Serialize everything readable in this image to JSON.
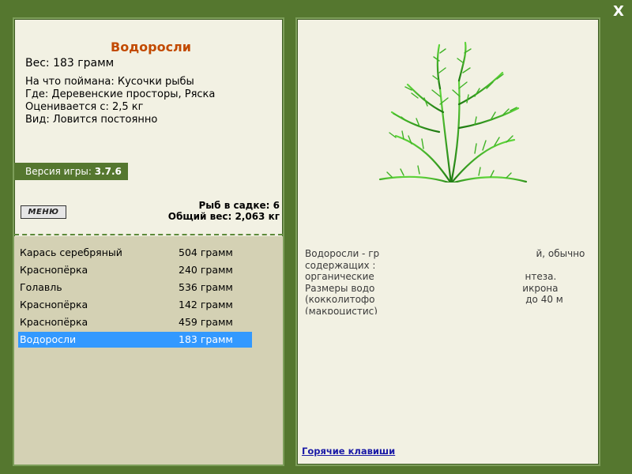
{
  "window": {
    "close_label": "X"
  },
  "fish": {
    "title": "Водоросли",
    "weight": "Вес: 183 грамм",
    "caught_on": "На что поймана: Кусочки рыбы",
    "location": "Где: Деревенские просторы, Ряска",
    "valued_from": "Оценивается с: 2,5 кг",
    "kind": "Вид: Ловится постоянно"
  },
  "version": {
    "label": "Версия игры: ",
    "value": "3.7.6"
  },
  "menu": {
    "label": "МЕНЮ"
  },
  "cage": {
    "fish_count": "Рыб в садке: 6",
    "total_weight": "Общий вес: 2,063 кг"
  },
  "catch_list": [
    {
      "name": "Карась серебряный",
      "weight": "504 грамм"
    },
    {
      "name": "Краснопёрка",
      "weight": "240 грамм"
    },
    {
      "name": "Голавль",
      "weight": "536 грамм"
    },
    {
      "name": "Краснопёрка",
      "weight": "142 грамм"
    },
    {
      "name": "Краснопёрка",
      "weight": "459 грамм"
    },
    {
      "name": "Водоросли",
      "weight": "183 грамм"
    }
  ],
  "selected_index": 5,
  "description": {
    "lines": [
      "Водоросли - гр                                                    й, обычно",
      "содержащих :",
      "органические                                                  нтеза.",
      "Размеры водо                                                 икрона",
      "(кокколитофо                                                  до 40 м",
      "(макроцистис)"
    ]
  },
  "hotkeys": {
    "label": "Горячие клавиши"
  },
  "colors": {
    "background": "#55772f",
    "panel": "#f2f1e3",
    "list_bg": "#d4d1b4",
    "title": "#c24a00",
    "selection": "#3399ff",
    "link": "#1a1aa6"
  },
  "icons": {
    "close": "close-icon",
    "item_image": "algae-plant-image"
  }
}
